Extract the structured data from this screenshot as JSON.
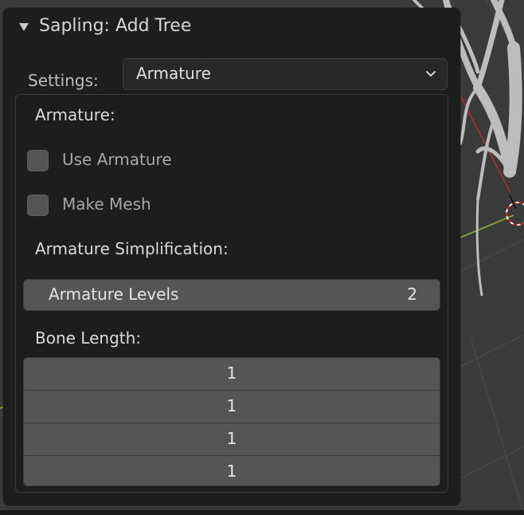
{
  "panel": {
    "title": "Sapling: Add Tree",
    "settings_label": "Settings:",
    "settings_value": "Armature"
  },
  "section": {
    "armature_heading": "Armature:",
    "use_armature_label": "Use Armature",
    "use_armature_checked": false,
    "make_mesh_label": "Make Mesh",
    "make_mesh_checked": false,
    "simplification_heading": "Armature Simplification:",
    "armature_levels_label": "Armature Levels",
    "armature_levels_value": "2",
    "bone_length_heading": "Bone Length:",
    "bone_length_values": [
      "1",
      "1",
      "1",
      "1"
    ]
  },
  "colors": {
    "panel_bg": "#1d1d1d",
    "field_bg": "#555555",
    "viewport_bg": "#3a3a3a"
  }
}
